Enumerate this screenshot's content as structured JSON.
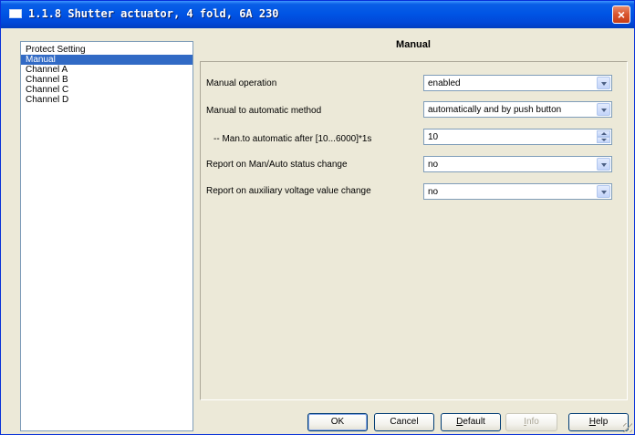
{
  "window": {
    "title": "1.1.8 Shutter actuator, 4 fold, 6A 230",
    "close_glyph": "×"
  },
  "sidebar": {
    "items": [
      {
        "label": "Protect Setting",
        "selected": false
      },
      {
        "label": "Manual",
        "selected": true
      },
      {
        "label": "Channel A",
        "selected": false
      },
      {
        "label": "Channel B",
        "selected": false
      },
      {
        "label": "Channel C",
        "selected": false
      },
      {
        "label": "Channel D",
        "selected": false
      }
    ]
  },
  "main": {
    "title": "Manual",
    "params": [
      {
        "label": "Manual operation",
        "value": "enabled",
        "control": "dropdown"
      },
      {
        "label": "Manual to automatic method",
        "value": "automatically and by push button",
        "control": "dropdown"
      },
      {
        "label": "-- Man.to automatic after [10...6000]*1s",
        "value": "10",
        "control": "spinner"
      },
      {
        "label": "Report on Man/Auto status change",
        "value": "no",
        "control": "dropdown"
      },
      {
        "label": "Report on auxiliary voltage value change",
        "value": "no",
        "control": "dropdown"
      }
    ]
  },
  "buttons": {
    "ok": "OK",
    "cancel": "Cancel",
    "default_first": "D",
    "default_rest": "efault",
    "info_first": "I",
    "info_rest": "nfo",
    "help_first": "H",
    "help_rest": "elp"
  },
  "colors": {
    "titlebar": "#0055e5",
    "selection": "#316ac5",
    "dialog_bg": "#ece9d8",
    "field_border": "#7f9db9"
  },
  "icons": {
    "dropdown": "chevron-down-icon",
    "spinner": "spinner-arrows-icon",
    "close": "close-icon",
    "app": "window-icon"
  }
}
